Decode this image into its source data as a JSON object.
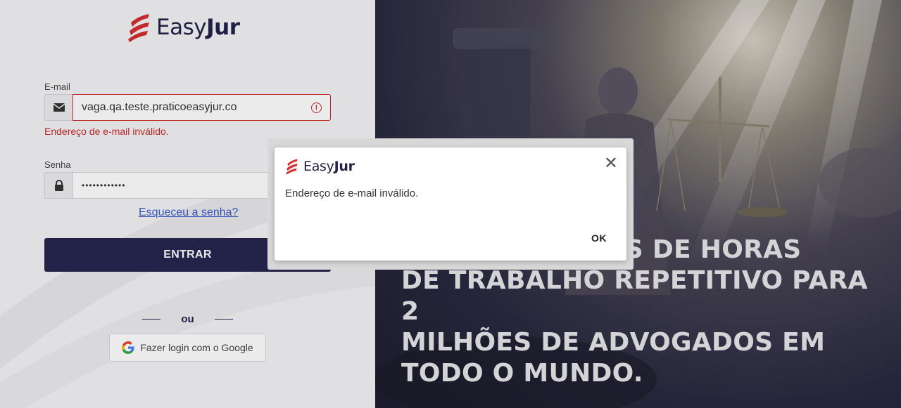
{
  "brand": {
    "name_light": "Easy",
    "name_bold": "Jur",
    "accent": "#d32f2f",
    "navy": "#262651"
  },
  "login": {
    "email_label": "E-mail",
    "email_value": "vaga.qa.teste.praticoeasyjur.co",
    "email_error": "Endereço de e-mail inválido.",
    "password_label": "Senha",
    "password_value": "••••••••••••",
    "forgot_link": "Esqueceu a senha?",
    "submit_label": "ENTRAR",
    "or_text": "ou",
    "google_label": "Fazer login com o Google"
  },
  "hero": {
    "headline": "...ILHÕES DE HORAS DE TRABALHO REPETITIVO PARA 2 MILHÕES DE ADVOGADOS EM TODO O MUNDO.",
    "line1": "ÕES DE HORAS",
    "line2": "DE TRABALHO REPETITIVO PARA 2",
    "line3": "MILHÕES DE ADVOGADOS EM",
    "line4": "TODO O MUNDO."
  },
  "dialog": {
    "brand_light": "Easy",
    "brand_bold": "Jur",
    "message": "Endereço de e-mail inválido.",
    "close_glyph": "✕",
    "ok_label": "OK"
  },
  "icons": [
    "logo-icon",
    "envelope-icon",
    "error-icon",
    "lock-icon",
    "google-icon",
    "close-icon"
  ]
}
